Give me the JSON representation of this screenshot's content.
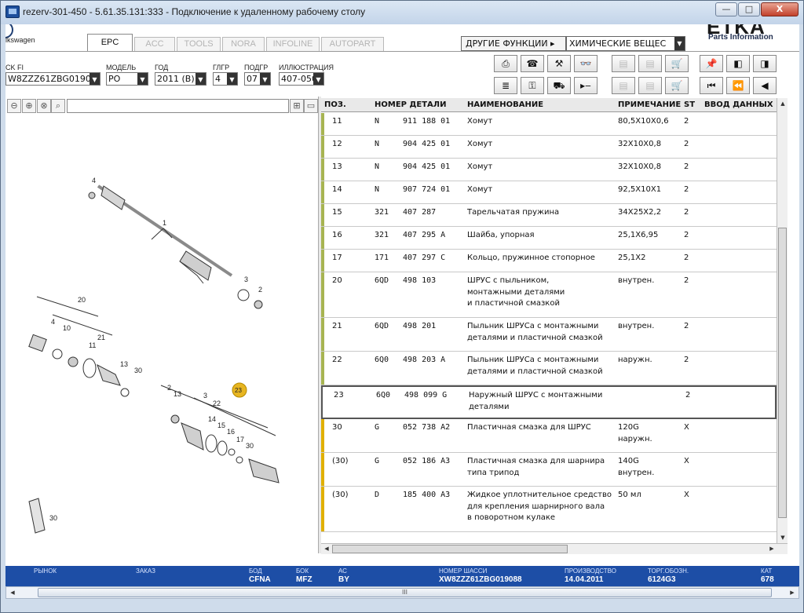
{
  "window": {
    "title": "rezerv-301-450 - 5.61.35.131:333 - Подключение к удаленному рабочему столу",
    "min_label": "—",
    "max_label": "□",
    "close_label": "X"
  },
  "header": {
    "brand": "lkswagen",
    "etka_logo": "ETKA",
    "etka_sub": "Parts Information",
    "tabs": [
      "EPC",
      "ACC",
      "TOOLS",
      "NORA",
      "INFOLINE",
      "AUTOPART"
    ],
    "active_tab": "EPC",
    "other_functions": "ДРУГИЕ ФУНКЦИИ ▸",
    "chemicals": "ХИМИЧЕСКИЕ ВЕЩЕС"
  },
  "filters": {
    "vin_label": "CK FI",
    "vin_value": "W8ZZZ61ZBG019088",
    "model_label": "МОДЕЛЬ",
    "model_value": "PO",
    "year_label": "ГОД",
    "year_value": "2011 (B)",
    "glgr_label": "ГЛГР",
    "glgr_value": "4",
    "podgr_label": "ПОДГР",
    "podgr_value": "07",
    "illus_label": "ИЛЛЮСТРАЦИЯ",
    "illus_value": "407-050"
  },
  "toolbar": {
    "row1": [
      "print-icon",
      "phone-icon",
      "handshake-icon",
      "glasses-icon",
      "elsa-icon",
      "depot-icon",
      "cart-out-icon",
      "pin-icon",
      "book-prev-icon",
      "book-next-icon"
    ],
    "row2": [
      "list-icon",
      "key-icon",
      "car-icon",
      "arrow-icon",
      "info-icon",
      "sub-icon",
      "cart-icon",
      "first-icon",
      "prev-icon",
      "back-icon"
    ],
    "row1_glyphs": [
      "⎙",
      "☎",
      "⚒",
      "👓",
      "▤",
      "▤",
      "🛒",
      "📌",
      "◧",
      "◨"
    ],
    "row2_glyphs": [
      "≣",
      "⚿",
      "⛟",
      "▸‒",
      "▤",
      "▤",
      "🛒",
      "⏮",
      "⏪",
      "◀"
    ],
    "row1_labels": [
      "",
      "",
      "",
      "",
      "ELSA",
      "DEPOT",
      "",
      "",
      "",
      ""
    ]
  },
  "table": {
    "headers": {
      "pos": "ПОЗ.",
      "part": "НОМЕР ДЕТАЛИ",
      "name": "НАИМЕНОВАНИЕ",
      "note": "ПРИМЕЧАНИЕ",
      "st": "ST",
      "input": "ВВОД ДАННЫХ ПО"
    },
    "rows": [
      {
        "pos": "11",
        "pfx": "N",
        "num": "911 188 01",
        "name": "Хомут",
        "note": "80,5X10X0,6",
        "st": "2",
        "color": "#a7b452"
      },
      {
        "pos": "12",
        "pfx": "N",
        "num": "904 425 01",
        "name": "Хомут",
        "note": "32X10X0,8",
        "st": "2",
        "color": "#a7b452"
      },
      {
        "pos": "13",
        "pfx": "N",
        "num": "904 425 01",
        "name": "Хомут",
        "note": "32X10X0,8",
        "st": "2",
        "color": "#a7b452"
      },
      {
        "pos": "14",
        "pfx": "N",
        "num": "907 724 01",
        "name": "Хомут",
        "note": "92,5X10X1",
        "st": "2",
        "color": "#a7b452"
      },
      {
        "pos": "15",
        "pfx": "321",
        "num": "407 287",
        "name": "Тарельчатая пружина",
        "note": "34X25X2,2",
        "st": "2",
        "color": "#a7b452"
      },
      {
        "pos": "16",
        "pfx": "321",
        "num": "407 295 A",
        "name": "Шайба, упорная",
        "note": "25,1X6,95",
        "st": "2",
        "color": "#a7b452"
      },
      {
        "pos": "17",
        "pfx": "171",
        "num": "407 297 C",
        "name": "Кольцо, пружинное стопорное",
        "note": "25,1X2",
        "st": "2",
        "color": "#a7b452"
      },
      {
        "pos": "20",
        "pfx": "6QD",
        "num": "498 103",
        "name": "ШРУС с пыльником,\nмонтажными деталями\nи пластичной смазкой",
        "note": "внутрен.",
        "st": "2",
        "color": "#a7b452"
      },
      {
        "pos": "21",
        "pfx": "6QD",
        "num": "498 201",
        "name": "Пыльник ШРУСа с монтажными\nдеталями и пластичной смазкой",
        "note": "внутрен.",
        "st": "2",
        "color": "#a7b452"
      },
      {
        "pos": "22",
        "pfx": "6Q0",
        "num": "498 203 A",
        "name": "Пыльник ШРУСа с монтажными\nдеталями и пластичной смазкой",
        "note": "наружн.",
        "st": "2",
        "color": "#a7b452"
      },
      {
        "pos": "23",
        "pfx": "6Q0",
        "num": "498 099 G",
        "name": "Наружный ШРУС с монтажными\nдеталями",
        "note": "",
        "st": "2",
        "color": "#ffffff"
      },
      {
        "pos": "30",
        "pfx": "G",
        "num": "052 738 A2",
        "name": "Пластичная смазка для ШРУС",
        "note": "120G\nнаружн.",
        "st": "X",
        "color": "#e0b000"
      },
      {
        "pos": "(30)",
        "pfx": "G",
        "num": "052 186 A3",
        "name": "Пластичная смазка для шарнира\nтипа трипод",
        "note": "140G\nвнутрен.",
        "st": "X",
        "color": "#e0b000"
      },
      {
        "pos": "(30)",
        "pfx": "D",
        "num": "185 400 A3",
        "name": "Жидкое уплотнительное средство\nдля крепления шарнирного вала\nв поворотном кулаке",
        "note": "50 мл",
        "st": "X",
        "color": "#e0b000"
      }
    ]
  },
  "diagram": {
    "callouts": [
      "4",
      "1",
      "3",
      "2",
      "20",
      "4",
      "10",
      "21",
      "11",
      "13",
      "30",
      "23",
      "2",
      "13",
      "3",
      "22",
      "14",
      "15",
      "16",
      "17",
      "30",
      "30"
    ],
    "highlight": "23"
  },
  "status": {
    "market_label": "РЫНОК",
    "order_label": "ЗАКАЗ",
    "bod_label": "БОД",
    "bod_value": "CFNA",
    "bok_label": "БОК",
    "bok_value": "MFZ",
    "ac_label": "АС",
    "ac_value": "BY",
    "chassis_label": "НОМЕР ШАССИ",
    "chassis_value": "XW8ZZZ61ZBG019088",
    "prod_label": "ПРОИЗВОДСТВО",
    "prod_value": "14.04.2011",
    "trade_label": "ТОРГ.ОБОЗН.",
    "trade_value": "6124G3",
    "cat_label": "КАТ",
    "cat_value": "678"
  },
  "scroll_grip": "III",
  "arrow_up": "▲",
  "arrow_down": "▼",
  "arrow_left": "◀",
  "arrow_right": "▶"
}
